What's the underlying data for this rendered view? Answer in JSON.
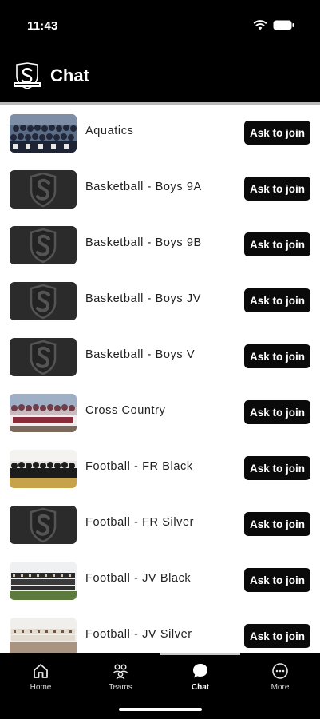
{
  "status_bar": {
    "time": "11:43",
    "icons": [
      "wifi-icon",
      "battery-icon"
    ]
  },
  "header": {
    "title": "Chat",
    "logo": "school-shield-logo"
  },
  "groups": [
    {
      "name": "Aquatics",
      "thumbnail": "team-photo",
      "action": "Ask to join"
    },
    {
      "name": "Basketball - Boys 9A",
      "thumbnail": "shield-logo",
      "action": "Ask to join"
    },
    {
      "name": "Basketball - Boys 9B",
      "thumbnail": "shield-logo",
      "action": "Ask to join"
    },
    {
      "name": "Basketball - Boys JV",
      "thumbnail": "shield-logo",
      "action": "Ask to join"
    },
    {
      "name": "Basketball - Boys V",
      "thumbnail": "shield-logo",
      "action": "Ask to join"
    },
    {
      "name": "Cross Country",
      "thumbnail": "team-photo",
      "action": "Ask to join"
    },
    {
      "name": "Football - FR Black",
      "thumbnail": "team-photo",
      "action": "Ask to join"
    },
    {
      "name": "Football - FR Silver",
      "thumbnail": "shield-logo",
      "action": "Ask to join"
    },
    {
      "name": "Football - JV Black",
      "thumbnail": "team-photo",
      "action": "Ask to join"
    },
    {
      "name": "Football - JV Silver",
      "thumbnail": "team-photo",
      "action": "Ask to join"
    }
  ],
  "tabs": [
    {
      "label": "Home",
      "icon": "home-icon",
      "active": false
    },
    {
      "label": "Teams",
      "icon": "teams-icon",
      "active": false
    },
    {
      "label": "Chat",
      "icon": "chat-icon",
      "active": true
    },
    {
      "label": "More",
      "icon": "more-icon",
      "active": false
    }
  ],
  "colors": {
    "background": "#000000",
    "list_background": "#ffffff",
    "button": "#0a0a0a",
    "text": "#222222"
  }
}
